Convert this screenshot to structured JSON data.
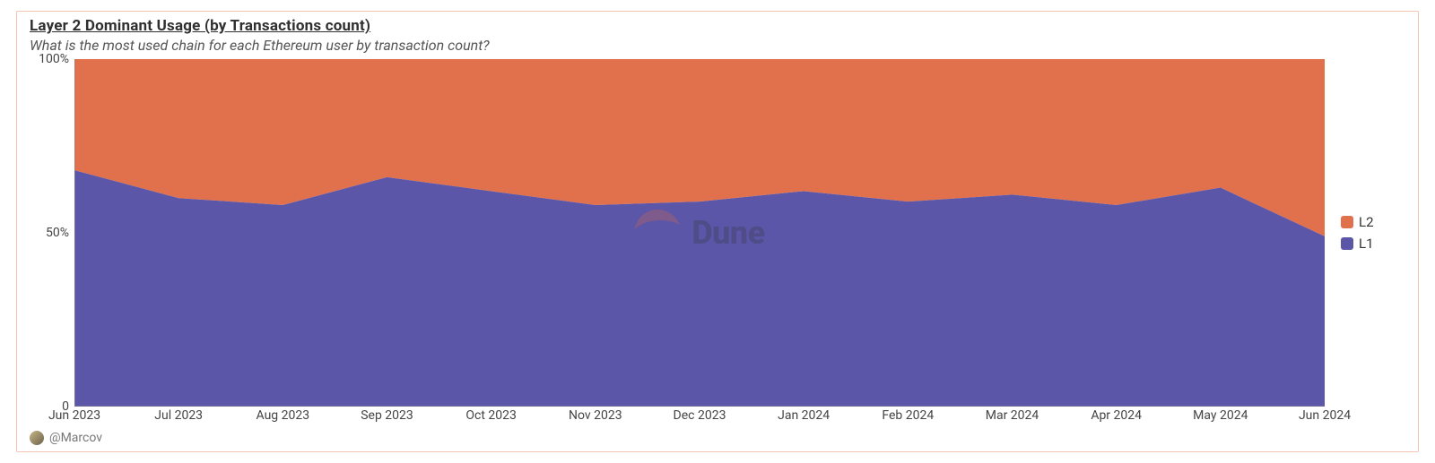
{
  "title": "Layer 2 Dominant Usage (by Transactions count)",
  "subtitle": "What is the most used chain for each Ethereum user by transaction count?",
  "author": "@Marcov",
  "watermark": "Dune",
  "legend": [
    {
      "name": "L2",
      "color": "#e1704c"
    },
    {
      "name": "L1",
      "color": "#5b56a8"
    }
  ],
  "yticks": [
    "0",
    "50%",
    "100%"
  ],
  "chart_data": {
    "type": "area",
    "stacked": true,
    "normalized_to": 100,
    "ylabel": "",
    "xlabel": "",
    "ylim": [
      0,
      100
    ],
    "categories": [
      "Jun 2023",
      "Jul 2023",
      "Aug 2023",
      "Sep 2023",
      "Oct 2023",
      "Nov 2023",
      "Dec 2023",
      "Jan 2024",
      "Feb 2024",
      "Mar 2024",
      "Apr 2024",
      "May 2024",
      "Jun 2024"
    ],
    "series": [
      {
        "name": "L1",
        "color": "#5b56a8",
        "values": [
          68,
          60,
          58,
          66,
          62,
          58,
          59,
          62,
          59,
          61,
          58,
          63,
          49
        ]
      },
      {
        "name": "L2",
        "color": "#e1704c",
        "values": [
          32,
          40,
          42,
          34,
          38,
          42,
          41,
          38,
          41,
          39,
          42,
          37,
          51
        ]
      }
    ]
  }
}
